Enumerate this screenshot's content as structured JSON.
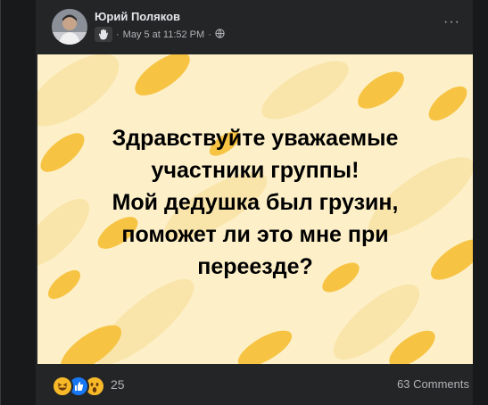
{
  "post": {
    "author": "Юрий Поляков",
    "date": "May 5 at 11:52 PM",
    "separator": "·",
    "privacy_icon": "globe-icon",
    "group_icon": "wave-hand-icon",
    "more_label": "···",
    "text_lines": [
      "Здравствуйте уважаемые",
      "участники группы!",
      "Мой дедушка был грузин,",
      "поможет ли это мне при",
      "переезде?"
    ],
    "background_color": "#fdf0c8",
    "blob_color": "#f7c343"
  },
  "footer": {
    "reaction_icons": [
      "laughing-emoji-icon",
      "like-icon",
      "wow-emoji-icon"
    ],
    "reaction_count": "25",
    "comments_label": "63 Comments"
  },
  "colors": {
    "page_bg": "#18191a",
    "card_bg": "#242526",
    "text_primary": "#e4e6eb",
    "text_secondary": "#b0b3b8",
    "like_blue": "#1877f2",
    "emoji_yellow": "#f7b928"
  }
}
